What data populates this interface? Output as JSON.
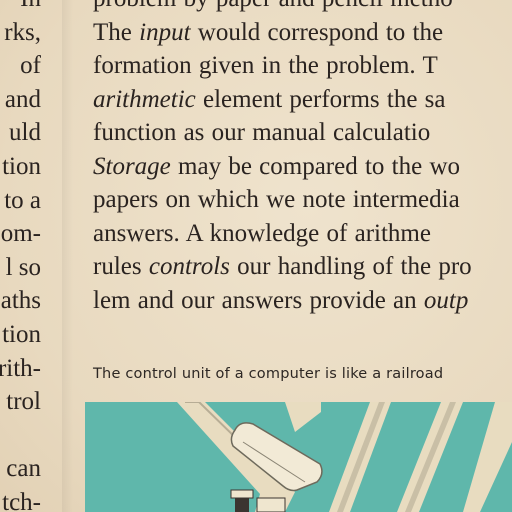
{
  "left_column": [
    "In",
    "rks,",
    "of",
    "and",
    "uld",
    "tion",
    "to a",
    "om-",
    "l so",
    "aths",
    "tion",
    "rith-",
    "trol",
    "",
    "can",
    "tch-"
  ],
  "main_column": {
    "lines": [
      [
        {
          "t": "problem by paper and pencil metho"
        }
      ],
      [
        {
          "t": "The "
        },
        {
          "t": "input",
          "i": true
        },
        {
          "t": " would correspond to the"
        }
      ],
      [
        {
          "t": "formation given in the problem. T"
        }
      ],
      [
        {
          "t": "arithmetic",
          "i": true
        },
        {
          "t": " element performs the sa"
        }
      ],
      [
        {
          "t": "function as our manual calculatio"
        }
      ],
      [
        {
          "t": "Storage",
          "i": true
        },
        {
          "t": " may be compared to the wo"
        }
      ],
      [
        {
          "t": "papers on which we note intermedia"
        }
      ],
      [
        {
          "t": "answers. A knowledge of arithme"
        }
      ],
      [
        {
          "t": "rules "
        },
        {
          "t": "controls",
          "i": true
        },
        {
          "t": " our handling of the pro"
        }
      ],
      [
        {
          "t": "lem and our answers provide an "
        },
        {
          "t": "outp",
          "i": true
        }
      ]
    ]
  },
  "caption": "The control unit of a computer is like a railroad",
  "colors": {
    "paper": "#ecdfc9",
    "ink": "#2a2320",
    "illustration_teal": "#5fb7ab",
    "illustration_cream": "#efe6cf"
  }
}
